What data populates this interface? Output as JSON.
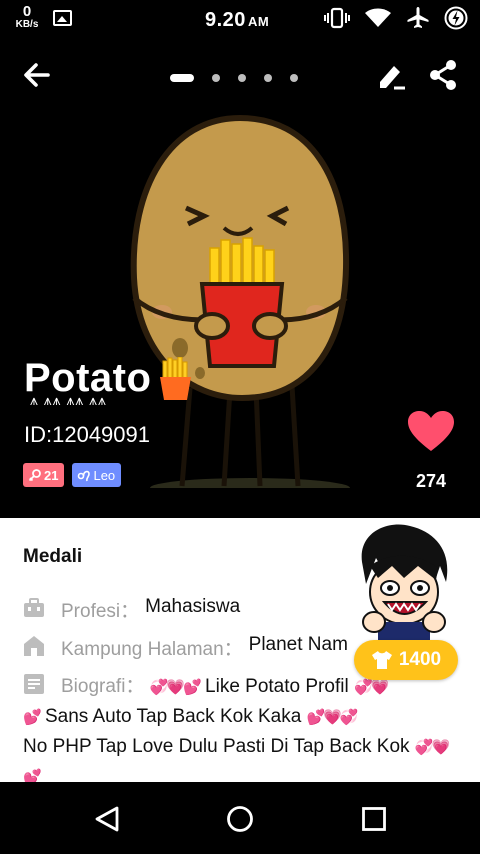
{
  "status_bar": {
    "net_speed": "0",
    "net_unit": "KB/s",
    "time": "9.20",
    "ampm": "AM",
    "icons": [
      "gallery-icon",
      "vibrate-icon",
      "wifi-icon",
      "airplane-icon",
      "battery-charging-icon"
    ]
  },
  "profile": {
    "nickname": "Potato",
    "rank_marks": "⩚ ⩚⩚ ⩚⩚ ⩚⩚",
    "id_text": "ID:12049091",
    "level_badge": "21",
    "zodiac_badge": "Leo",
    "like_count": "274",
    "photo_pages": 5,
    "active_page": 1,
    "colors": {
      "level": "#ff6f7e",
      "zodiac": "#6f8dff",
      "heart": "#ff4f6d",
      "coin": "#ffc21a"
    }
  },
  "info": {
    "section_title": "Medali",
    "profesi_label": "Profesi：",
    "profesi_value": "Mahasiswa",
    "kampung_label": "Kampung Halaman：",
    "kampung_value": "Planet Nam",
    "bio_label": "Biografi：",
    "bio_text_1": "Like Potato Profil",
    "bio_text_2": "Sans Auto Tap Back Kok Kaka",
    "bio_text_3": "No PHP Tap Love Dulu Pasti Di Tap Back Kok",
    "coin_amount": "1400"
  },
  "nav": [
    "back-nav-icon",
    "home-nav-icon",
    "recent-apps-icon"
  ]
}
